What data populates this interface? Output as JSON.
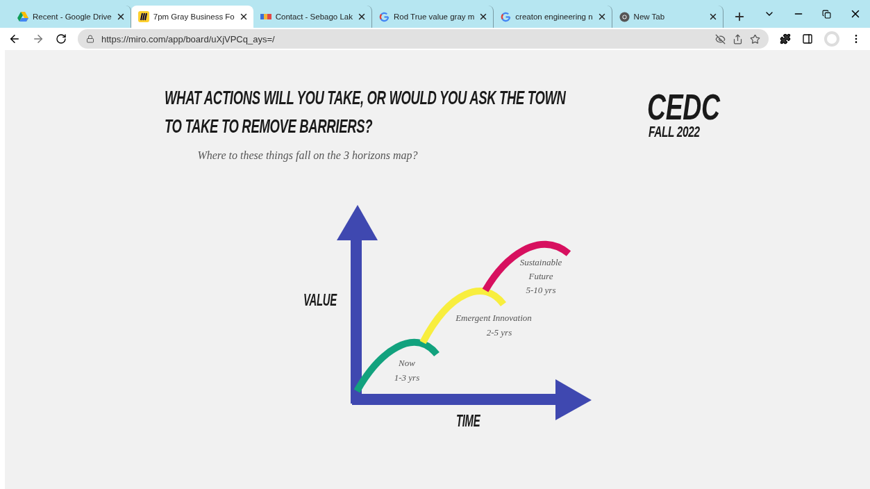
{
  "browser": {
    "tabs": [
      {
        "title": "Recent - Google Drive",
        "kind": "drive",
        "selected": false
      },
      {
        "title": "7pm Gray Business Fo",
        "kind": "miro",
        "selected": true
      },
      {
        "title": "Contact - Sebago Lak",
        "kind": "contact",
        "selected": false
      },
      {
        "title": "Rod True value gray m",
        "kind": "google",
        "selected": false
      },
      {
        "title": "creaton engineering n",
        "kind": "google",
        "selected": false
      },
      {
        "title": "New Tab",
        "kind": "chrome",
        "selected": false
      }
    ],
    "url": "https://miro.com/app/board/uXjVPCq_ays=/"
  },
  "board": {
    "title_lines": [
      "WHAT ACTIONS WILL YOU TAKE, OR WOULD YOU ASK THE TOWN",
      "TO TAKE TO REMOVE BARRIERS?"
    ],
    "subtitle": "Where to these things fall on the 3 horizons map?",
    "logo": "CEDC",
    "logo_sub": "FALL 2022",
    "y_axis_label": "VALUE",
    "x_axis_label": "TIME",
    "horizons": [
      {
        "name": "Now",
        "span": "1-3 yrs",
        "color": "#12a27e"
      },
      {
        "name": "Emergent Innovation",
        "span": "2-5 yrs",
        "color": "#f8ee3e"
      },
      {
        "name": "Sustainable Future",
        "span": "5-10 yrs",
        "color": "#d7105f"
      }
    ]
  }
}
